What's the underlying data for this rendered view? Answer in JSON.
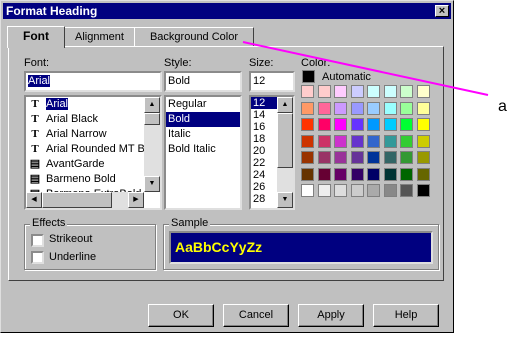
{
  "dialog": {
    "title": "Format Heading",
    "close_glyph": "×"
  },
  "tabs": [
    {
      "label": "Font",
      "active": true
    },
    {
      "label": "Alignment",
      "active": false
    },
    {
      "label": "Background Color",
      "active": false
    }
  ],
  "font": {
    "label": "Font:",
    "value": "Arial",
    "items": [
      {
        "name": "Arial",
        "icon": "truetype-icon",
        "selected": true
      },
      {
        "name": "Arial Black",
        "icon": "truetype-icon"
      },
      {
        "name": "Arial Narrow",
        "icon": "truetype-icon"
      },
      {
        "name": "Arial Rounded MT B",
        "icon": "truetype-icon"
      },
      {
        "name": "AvantGarde",
        "icon": "printer-font-icon"
      },
      {
        "name": "Barmeno Bold",
        "icon": "printer-font-icon"
      },
      {
        "name": "Barmeno ExtraBold",
        "icon": "printer-font-icon"
      }
    ]
  },
  "style": {
    "label": "Style:",
    "value": "Bold",
    "items": [
      "Regular",
      "Bold",
      "Italic",
      "Bold Italic"
    ],
    "selected_index": 1
  },
  "size": {
    "label": "Size:",
    "value": "12",
    "items": [
      "12",
      "14",
      "16",
      "18",
      "20",
      "22",
      "24",
      "26",
      "28"
    ],
    "selected_index": 0
  },
  "color": {
    "label": "Color:",
    "automatic_label": "Automatic",
    "automatic_color": "#000000",
    "palette": [
      [
        "#ffcccc",
        "#ffcccc",
        "#ffccff",
        "#ccccff",
        "#ccffff",
        "#ccffff",
        "#ccffcc",
        "#ffffcc"
      ],
      [
        "#ff9966",
        "#ff6699",
        "#cc99ff",
        "#9999ff",
        "#99ccff",
        "#99ffff",
        "#99ff99",
        "#ffff99"
      ],
      [
        "#ff3300",
        "#ff0066",
        "#ff00ff",
        "#6633ff",
        "#0099ff",
        "#00ccff",
        "#00ff33",
        "#ffff00"
      ],
      [
        "#cc3300",
        "#cc3366",
        "#cc33cc",
        "#6633cc",
        "#3366cc",
        "#339999",
        "#33cc33",
        "#cccc00"
      ],
      [
        "#993300",
        "#993366",
        "#993399",
        "#663399",
        "#003399",
        "#336666",
        "#339933",
        "#999900"
      ],
      [
        "#663300",
        "#660033",
        "#660066",
        "#330066",
        "#000066",
        "#003333",
        "#006600",
        "#666600"
      ],
      [
        "#ffffff",
        "#eeeeee",
        "#dddddd",
        "#cccccc",
        "#aaaaaa",
        "#888888",
        "#555555",
        "#000000"
      ]
    ]
  },
  "effects": {
    "group_label": "Effects",
    "strikeout_label": "Strikeout",
    "underline_label": "Underline"
  },
  "sample": {
    "group_label": "Sample",
    "text": "AaBbCcYyZz",
    "bg_color": "#000080",
    "text_color": "#ffff00"
  },
  "buttons": {
    "ok": "OK",
    "cancel": "Cancel",
    "apply": "Apply",
    "help": "Help"
  },
  "annotation": {
    "label": "a",
    "color": "#ff00ff"
  }
}
